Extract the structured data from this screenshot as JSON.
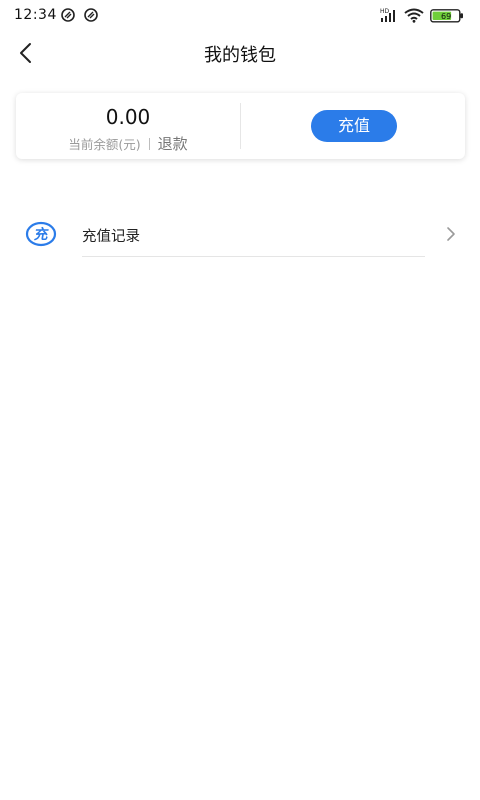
{
  "status_bar": {
    "time": "12:34",
    "network_type": "HD",
    "battery_level": "69",
    "icons": [
      "notification-icon-1",
      "notification-icon-2",
      "signal-icon",
      "wifi-icon",
      "battery-icon"
    ]
  },
  "header": {
    "title": "我的钱包",
    "back_icon": "chevron-left-icon"
  },
  "wallet": {
    "balance": "0.00",
    "balance_label": "当前余额(元)",
    "refund_label": "退款",
    "recharge_label": "充值"
  },
  "menu": {
    "items": [
      {
        "label": "充值记录",
        "icon": "recharge-icon",
        "icon_text": "充",
        "chevron": "chevron-right-icon"
      }
    ]
  },
  "colors": {
    "accent": "#2b7ce9",
    "battery_fill": "#6fcf3a"
  }
}
